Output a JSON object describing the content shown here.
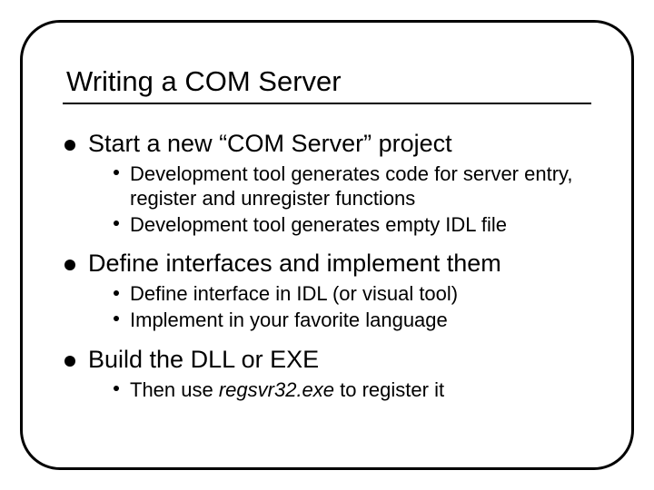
{
  "title": "Writing a COM Server",
  "bullets": [
    {
      "text": "Start a new “COM Server” project",
      "sub": [
        {
          "text": "Development tool generates code for server entry, register and unregister functions"
        },
        {
          "text": "Development tool generates empty IDL file"
        }
      ]
    },
    {
      "text": "Define interfaces and implement them",
      "sub": [
        {
          "text": "Define interface in IDL (or visual tool)"
        },
        {
          "text": "Implement in your favorite language"
        }
      ]
    },
    {
      "text": "Build the DLL or EXE",
      "sub": [
        {
          "prefix": "Then use ",
          "em": "regsvr32.exe",
          "suffix": " to register it"
        }
      ]
    }
  ]
}
